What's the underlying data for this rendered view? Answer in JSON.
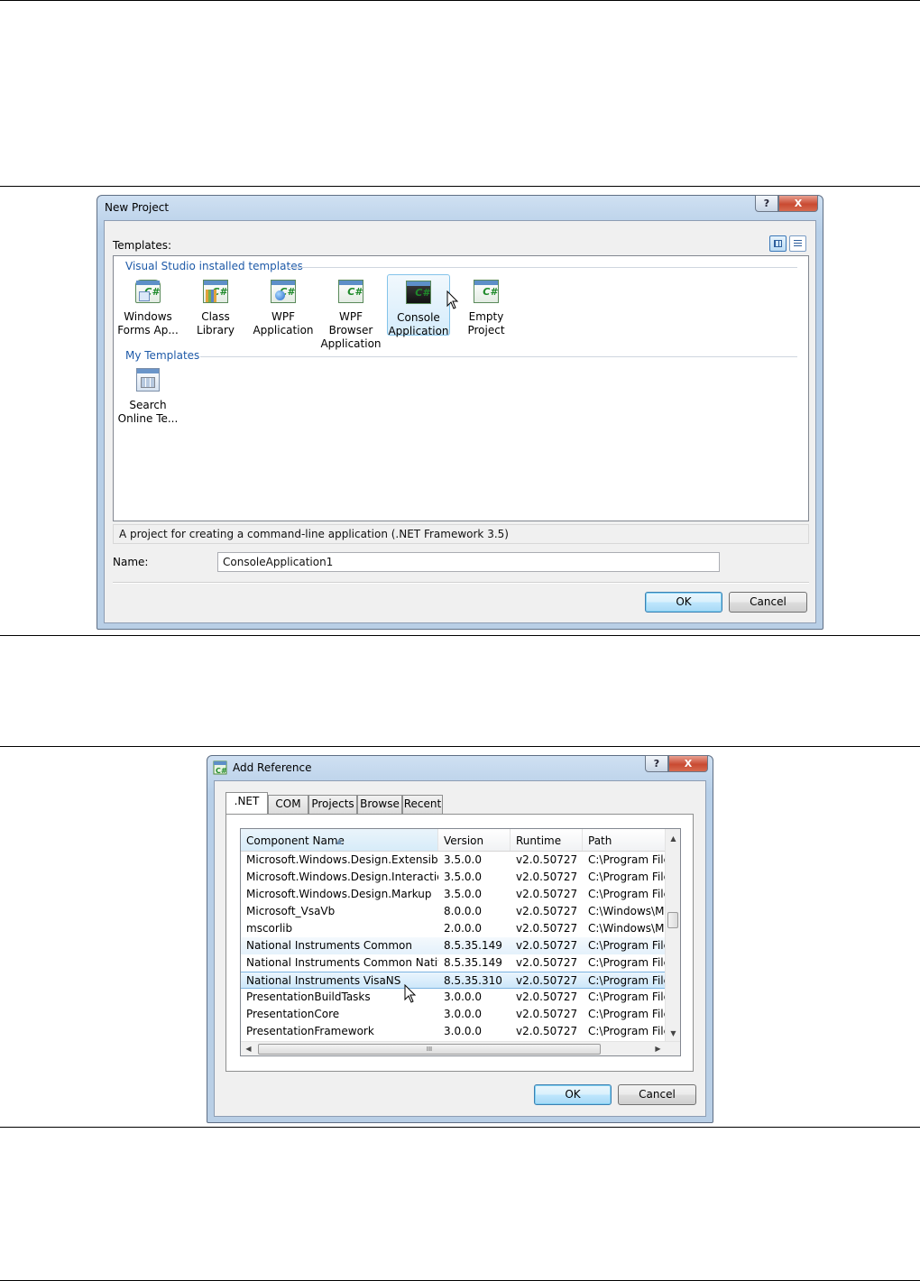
{
  "new_project": {
    "title": "New Project",
    "help_glyph": "?",
    "close_glyph": "X",
    "templates_label": "Templates:",
    "installed_group": "Visual Studio installed templates",
    "installed_templates": [
      {
        "line1": "Windows",
        "line2": "Forms Ap...",
        "icon": "windows-forms-icon"
      },
      {
        "line1": "Class Library",
        "line2": "",
        "icon": "class-library-icon"
      },
      {
        "line1": "WPF",
        "line2": "Application",
        "icon": "wpf-application-icon"
      },
      {
        "line1": "WPF Browser",
        "line2": "Application",
        "icon": "wpf-browser-icon"
      },
      {
        "line1": "Console",
        "line2": "Application",
        "icon": "console-application-icon",
        "selected": true
      },
      {
        "line1": "Empty",
        "line2": "Project",
        "icon": "empty-project-icon"
      }
    ],
    "my_group": "My Templates",
    "my_templates": [
      {
        "line1": "Search",
        "line2": "Online Te...",
        "icon": "search-online-icon"
      }
    ],
    "description": "A project for creating a command-line application (.NET Framework 3.5)",
    "name_label": "Name:",
    "name_value": "ConsoleApplication1",
    "ok_label": "OK",
    "cancel_label": "Cancel"
  },
  "add_reference": {
    "title": "Add Reference",
    "help_glyph": "?",
    "close_glyph": "X",
    "tabs": [
      ".NET",
      "COM",
      "Projects",
      "Browse",
      "Recent"
    ],
    "columns": [
      "Component Name",
      "Version",
      "Runtime",
      "Path"
    ],
    "rows": [
      {
        "name": "Microsoft.Windows.Design.Extensibility",
        "version": "3.5.0.0",
        "runtime": "v2.0.50727",
        "path": "C:\\Program Files"
      },
      {
        "name": "Microsoft.Windows.Design.Interaction",
        "version": "3.5.0.0",
        "runtime": "v2.0.50727",
        "path": "C:\\Program Files"
      },
      {
        "name": "Microsoft.Windows.Design.Markup",
        "version": "3.5.0.0",
        "runtime": "v2.0.50727",
        "path": "C:\\Program Files"
      },
      {
        "name": "Microsoft_VsaVb",
        "version": "8.0.0.0",
        "runtime": "v2.0.50727",
        "path": "C:\\Windows\\Mi"
      },
      {
        "name": "mscorlib",
        "version": "2.0.0.0",
        "runtime": "v2.0.50727",
        "path": "C:\\Windows\\Mi"
      },
      {
        "name": "National Instruments Common",
        "version": "8.5.35.149",
        "runtime": "v2.0.50727",
        "path": "C:\\Program Files"
      },
      {
        "name": "National Instruments Common Nativ...",
        "version": "8.5.35.149",
        "runtime": "v2.0.50727",
        "path": "C:\\Program Files"
      },
      {
        "name": "National Instruments VisaNS",
        "version": "8.5.35.310",
        "runtime": "v2.0.50727",
        "path": "C:\\Program Files"
      },
      {
        "name": "PresentationBuildTasks",
        "version": "3.0.0.0",
        "runtime": "v2.0.50727",
        "path": "C:\\Program Files"
      },
      {
        "name": "PresentationCore",
        "version": "3.0.0.0",
        "runtime": "v2.0.50727",
        "path": "C:\\Program Files"
      },
      {
        "name": "PresentationFramework",
        "version": "3.0.0.0",
        "runtime": "v2.0.50727",
        "path": "C:\\Program Files"
      }
    ],
    "hscroll_grip": "III",
    "ok_label": "OK",
    "cancel_label": "Cancel"
  }
}
